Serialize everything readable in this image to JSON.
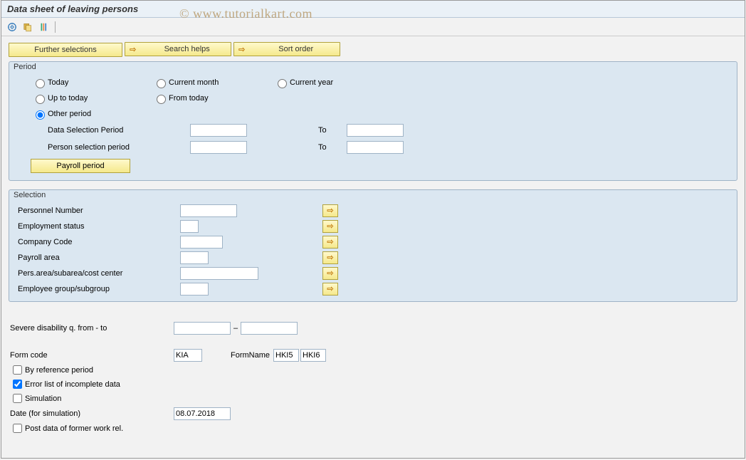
{
  "page_title": "Data sheet of leaving persons",
  "watermark": "© www.tutorialkart.com",
  "top_buttons": {
    "further": "Further selections",
    "search_helps": "Search helps",
    "sort_order": "Sort order"
  },
  "period": {
    "title": "Period",
    "opts": {
      "today": "Today",
      "current_month": "Current month",
      "current_year": "Current year",
      "up_to_today": "Up to today",
      "from_today": "From today",
      "other": "Other period"
    },
    "data_sel_label": "Data Selection Period",
    "person_sel_label": "Person selection period",
    "to_label": "To",
    "payroll_btn": "Payroll period",
    "data_sel_from": "",
    "data_sel_to": "",
    "person_sel_from": "",
    "person_sel_to": ""
  },
  "selection": {
    "title": "Selection",
    "rows": [
      {
        "label": "Personnel Number",
        "val": "",
        "w": "80"
      },
      {
        "label": "Employment status",
        "val": "",
        "w": "26"
      },
      {
        "label": "Company Code",
        "val": "",
        "w": "60"
      },
      {
        "label": "Payroll area",
        "val": "",
        "w": "40"
      },
      {
        "label": "Pers.area/subarea/cost center",
        "val": "",
        "w": "110"
      },
      {
        "label": "Employee group/subgroup",
        "val": "",
        "w": "40"
      }
    ]
  },
  "lower": {
    "severe_label": "Severe disability q. from - to",
    "severe_from": "",
    "severe_to": "",
    "dash": "–",
    "form_code_label": "Form code",
    "form_code_val": "KIA",
    "form_name_label": "FormName",
    "form_name_1": "HKI5",
    "form_name_2": "HKI6",
    "by_ref": "By reference period",
    "error_list": "Error list of incomplete data",
    "simulation": "Simulation",
    "date_sim_label": "Date (for simulation)",
    "date_sim_val": "08.07.2018",
    "post_former": "Post data of former work rel."
  }
}
